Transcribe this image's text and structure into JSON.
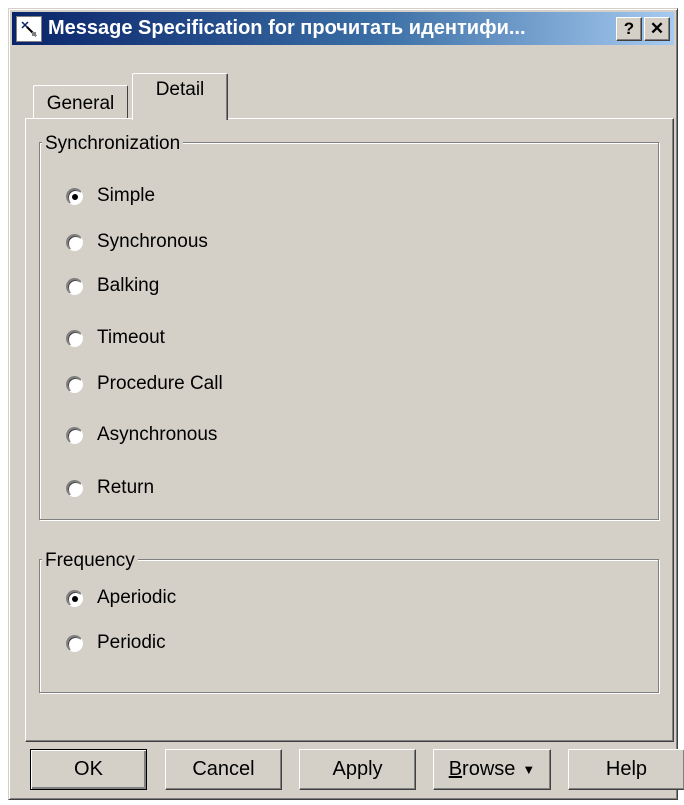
{
  "window": {
    "title": "Message Specification for прочитать идентифи...",
    "help_button": "?",
    "close_button": "✕"
  },
  "tabs": [
    {
      "label": "General",
      "active": false
    },
    {
      "label": "Detail",
      "active": true
    }
  ],
  "synchronization": {
    "legend": "Synchronization",
    "selected": "Simple",
    "options": [
      "Simple",
      "Synchronous",
      "Balking",
      "Timeout",
      "Procedure Call",
      "Asynchronous",
      "Return"
    ]
  },
  "frequency": {
    "legend": "Frequency",
    "selected": "Aperiodic",
    "options": [
      "Aperiodic",
      "Periodic"
    ]
  },
  "buttons": {
    "ok": "OK",
    "cancel": "Cancel",
    "apply": "Apply",
    "browse_mnemonic": "B",
    "browse_rest": "rowse",
    "browse_arrow": "▼",
    "help": "Help"
  },
  "colors": {
    "face": "#d4d0c8",
    "title_start": "#0a246a",
    "title_end": "#a6caf0"
  }
}
